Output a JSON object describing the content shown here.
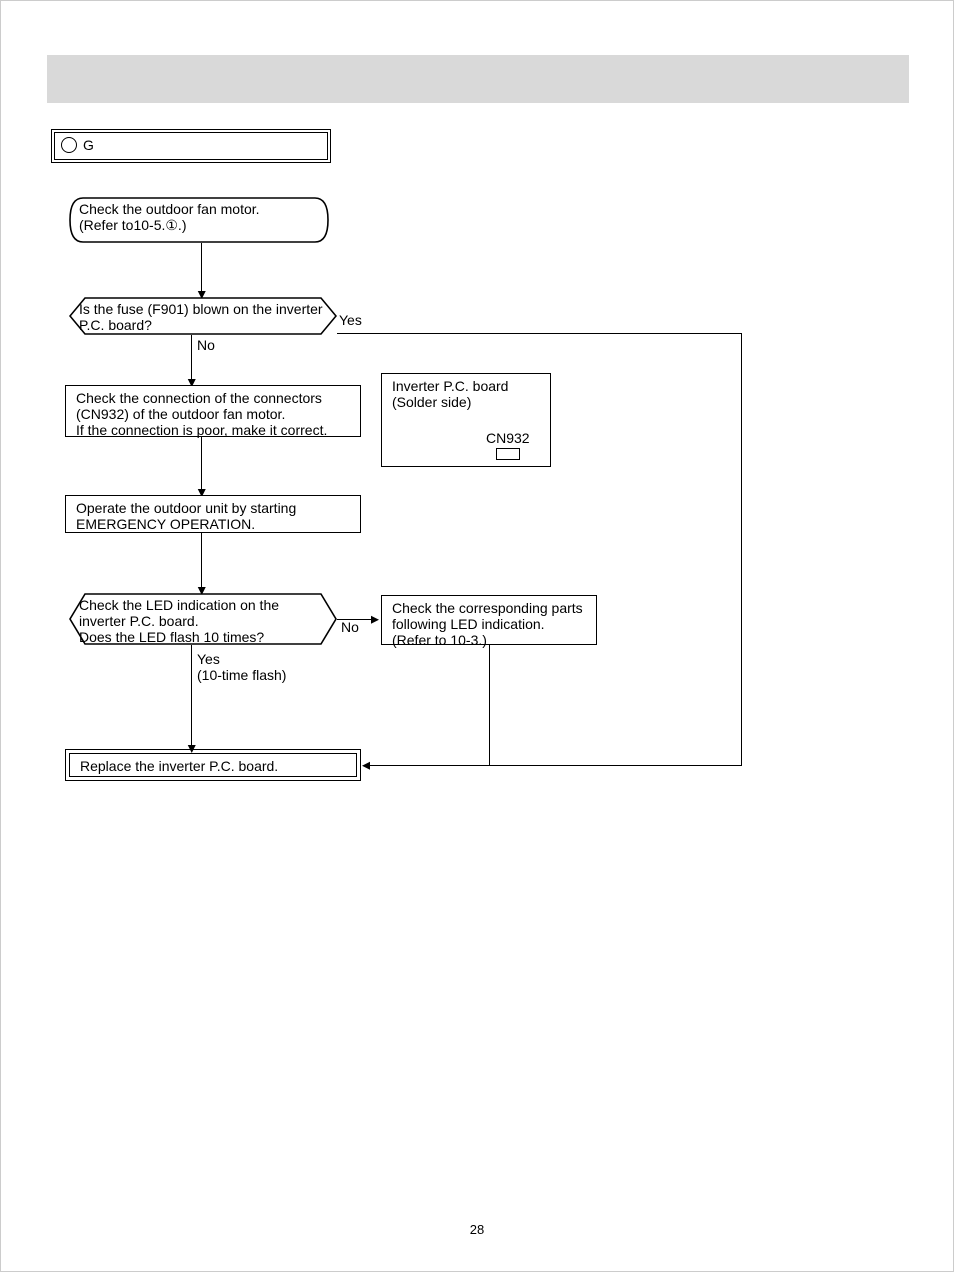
{
  "page_number": "28",
  "title": {
    "marker": "G",
    "text": ""
  },
  "nodes": {
    "n1": "Check the outdoor fan motor.\n(Refer to10-5.①.)",
    "n2": "Is the fuse (F901) blown on the inverter P.C. board?",
    "n3": "Check the connection of the connectors (CN932) of the outdoor fan motor.\nIf the connection is poor, make it correct.",
    "n4": "Operate the outdoor unit by starting EMERGENCY OPERATION.",
    "n5": "Check the LED indication on the inverter P.C. board.\nDoes the LED flash 10 times?",
    "n6": "Check the corresponding parts following LED indication.\n(Refer to 10-3.)",
    "n7": "Replace the inverter P.C. board.",
    "pcb_title": "Inverter P.C. board\n(Solder side)",
    "pcb_conn": "CN932"
  },
  "labels": {
    "yes1": "Yes",
    "no1": "No",
    "no2": "No",
    "yes2": "Yes\n(10-time flash)"
  }
}
